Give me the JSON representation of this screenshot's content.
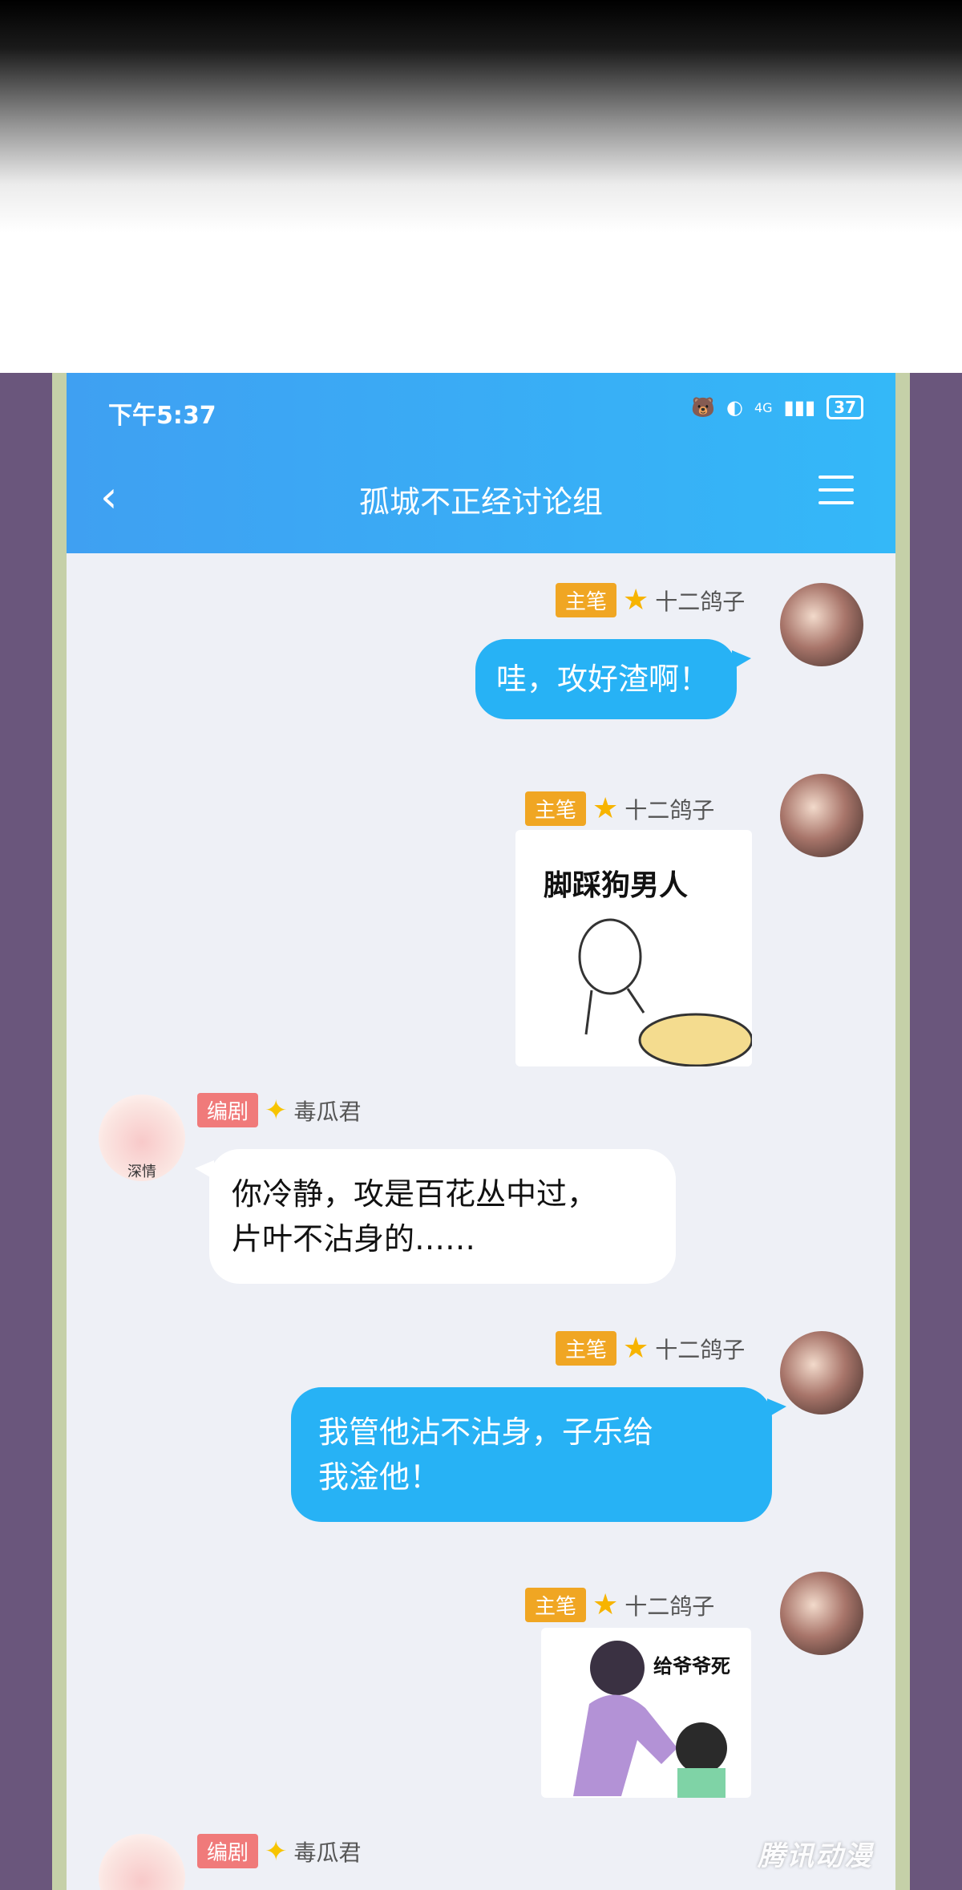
{
  "status_bar": {
    "time": "下午5:37",
    "network": "4G",
    "battery": "37"
  },
  "header": {
    "back_icon": "chevron-left-icon",
    "title": "孤城不正经讨论组",
    "menu_icon": "menu-icon"
  },
  "messages": [
    {
      "side": "right",
      "role_badge": "主笔",
      "role_icon": "star-icon",
      "sender": "十二鸽子",
      "type": "text",
      "text": "哇，攻好渣啊！"
    },
    {
      "side": "right",
      "role_badge": "主笔",
      "role_icon": "star-icon",
      "sender": "十二鸽子",
      "type": "sticker",
      "caption": "脚踩狗男人"
    },
    {
      "side": "left",
      "role_badge": "编剧",
      "role_icon": "diamond-icon",
      "sender": "毒瓜君",
      "avatar_caption": "深情",
      "type": "text",
      "lines": [
        "你冷静，攻是百花丛中过，",
        "片叶不沾身的……"
      ]
    },
    {
      "side": "right",
      "role_badge": "主笔",
      "role_icon": "star-icon",
      "sender": "十二鸽子",
      "type": "text",
      "lines": [
        "我管他沾不沾身，子乐给",
        "我淦他！"
      ]
    },
    {
      "side": "right",
      "role_badge": "主笔",
      "role_icon": "star-icon",
      "sender": "十二鸽子",
      "type": "sticker",
      "caption": "给爷爷死"
    },
    {
      "side": "left",
      "role_badge": "编剧",
      "role_icon": "diamond-icon",
      "sender": "毒瓜君"
    }
  ],
  "watermark": "腾讯动漫",
  "colors": {
    "header_start": "#3fa0f2",
    "header_end": "#34b8f8",
    "bubble_blue": "#27b2f5",
    "badge_gold": "#f0a623",
    "badge_red": "#f07a7a",
    "frame": "#6a567c"
  }
}
